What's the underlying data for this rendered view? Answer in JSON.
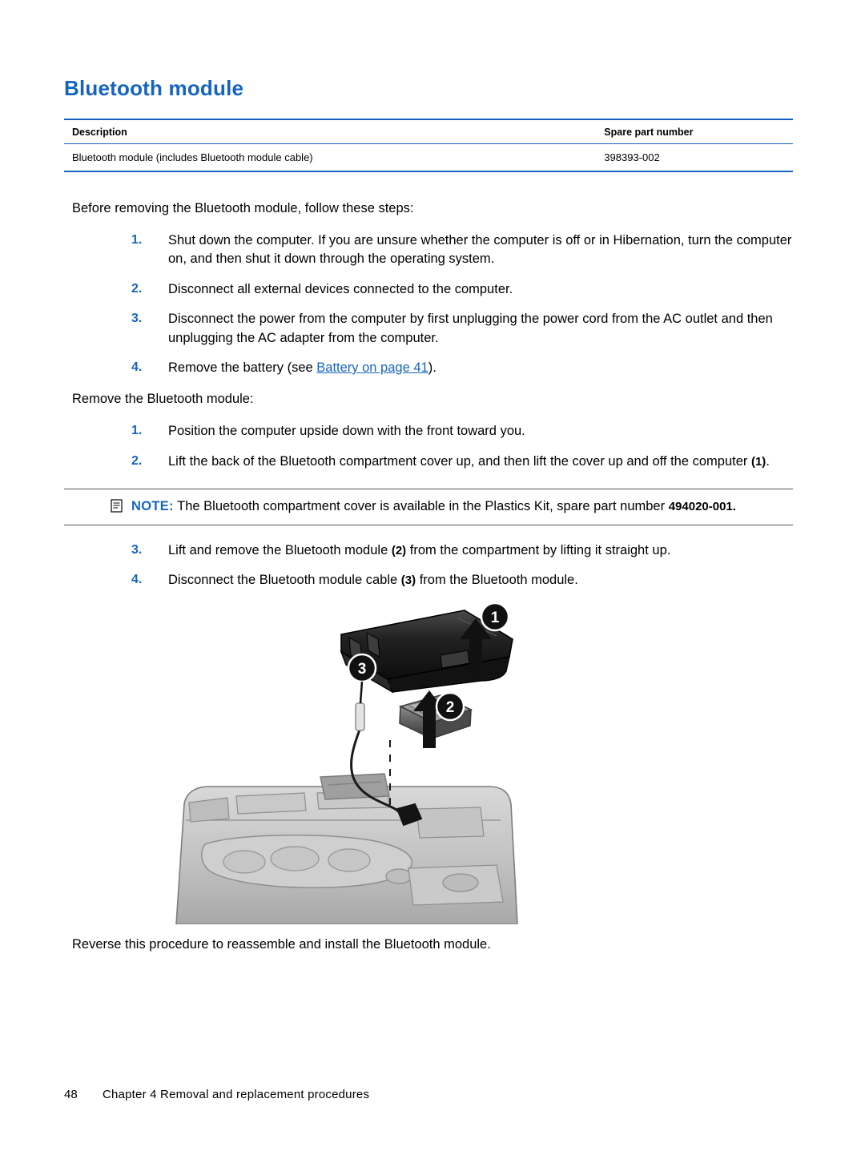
{
  "page": {
    "title": "Bluetooth module"
  },
  "table": {
    "headers": [
      "Description",
      "Spare part number"
    ],
    "rows": [
      [
        "Bluetooth module (includes Bluetooth module cable)",
        "398393-002"
      ]
    ]
  },
  "intro": "Before removing the Bluetooth module, follow these steps:",
  "prep_steps": [
    {
      "num": "1.",
      "text": "Shut down the computer. If you are unsure whether the computer is off or in Hibernation, turn the computer on, and then shut it down through the operating system."
    },
    {
      "num": "2.",
      "text": "Disconnect all external devices connected to the computer."
    },
    {
      "num": "3.",
      "text": "Disconnect the power from the computer by first unplugging the power cord from the AC outlet and then unplugging the AC adapter from the computer."
    }
  ],
  "step4": {
    "num": "4.",
    "pre": "Remove the battery (see ",
    "link": "Battery on page 41",
    "post": ")."
  },
  "remove_heading": "Remove the Bluetooth module:",
  "remove_steps": {
    "s1": {
      "num": "1.",
      "text": "Position the computer upside down with the front toward you."
    },
    "s2": {
      "num": "2.",
      "pre": "Lift the back of the Bluetooth compartment cover up, and then lift the cover up and off the computer ",
      "callout": "(1)",
      "post": "."
    },
    "s3": {
      "num": "3.",
      "pre": "Lift and remove the Bluetooth module ",
      "callout": "(2)",
      "post": " from the compartment by lifting it straight up."
    },
    "s4": {
      "num": "4.",
      "pre": "Disconnect the Bluetooth module cable ",
      "callout": "(3)",
      "post": " from the Bluetooth module."
    }
  },
  "note": {
    "label": "NOTE:",
    "text": "The Bluetooth compartment cover is available in the Plastics Kit, spare part number",
    "partnumber": "494020-001."
  },
  "figure": {
    "callouts": [
      "1",
      "2",
      "3"
    ]
  },
  "closing": "Reverse this procedure to reassemble and install the Bluetooth module.",
  "footer": {
    "page_number": "48",
    "chapter": "Chapter 4   Removal and replacement procedures"
  },
  "colors": {
    "accent": "#1565c0",
    "text": "#000000"
  }
}
